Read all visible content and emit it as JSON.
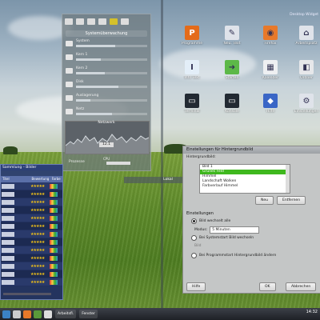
{
  "sysmon": {
    "header": "Systemüberwachung",
    "rows": [
      {
        "label": "System",
        "value": "",
        "fill": 0.55
      },
      {
        "label": "Kern 1",
        "value": "",
        "fill": 0.35
      },
      {
        "label": "Kern 2",
        "value": "",
        "fill": 0.4
      },
      {
        "label": "Disk",
        "value": "",
        "fill": 0.6
      },
      {
        "label": "Auslagerung",
        "value": "",
        "fill": 0.2
      },
      {
        "label": "Netz",
        "value": "",
        "fill": 0.5
      }
    ],
    "graph_label": "Netzwerk",
    "graph_value": "12.1",
    "bottom_label": "Prozesse",
    "bottom_mini": "CPU",
    "footer": "Lokal"
  },
  "desktop_icons": [
    {
      "name": "P",
      "caption": "Programme",
      "color": "#e46b1a"
    },
    {
      "name": "✎",
      "caption": "Neu. Text",
      "color": "#dfe3ea"
    },
    {
      "name": "◉",
      "caption": "Firefox",
      "color": "#e8792a"
    },
    {
      "name": "⌂",
      "caption": "Arbeitsplatz",
      "color": "#dfe3ea"
    },
    {
      "name": "I",
      "caption": "Info Text",
      "color": "#e3eef8"
    },
    {
      "name": "➜",
      "caption": "Starten",
      "color": "#5cb848"
    },
    {
      "name": "▦",
      "caption": "Kalender",
      "color": "#eef0f2"
    },
    {
      "name": "◧",
      "caption": "Ordner",
      "color": "#e6e7ea"
    },
    {
      "name": "▭",
      "caption": "Terminal",
      "color": "#222a33"
    },
    {
      "name": "▭",
      "caption": "Konsole",
      "color": "#222a33"
    },
    {
      "name": "◆",
      "caption": "Hilfe",
      "color": "#3a66c6"
    },
    {
      "name": "⚙",
      "caption": "Einstellungen",
      "color": "#dfe3ea"
    }
  ],
  "topright_text": "Desktop Widget",
  "collection": {
    "title": "Sammlung – Bilder",
    "headers": [
      "Titel",
      "Bewertung",
      "Farbe"
    ],
    "rows": 13
  },
  "dialog": {
    "title": "Einstellungen für Hintergrundbild",
    "subtitle": "Hintergrundbild:",
    "list_items": [
      "Bild 1",
      "Grünes Feld",
      "Himmel",
      "Landschaft Wolken",
      "Farbverlauf Himmel"
    ],
    "selected_index": 1,
    "btn_new": "Neu",
    "btn_remove": "Entfernen",
    "section": "Einstellungen",
    "option1": "Bild wechselt alle",
    "interval_label": "Modus:",
    "interval_value": "5 Minuten",
    "option2": "Bei Systemstart Bild wechseln",
    "option2b": "Bild",
    "option3": "Bei Programmstart Hintergrundbild ändern",
    "btn_help": "Hilfe",
    "btn_ok": "OK",
    "btn_cancel": "Abbrechen"
  },
  "taskbar": {
    "task1": "Arbeitsfl.",
    "task2": "Fenster",
    "clock": "14:32"
  }
}
